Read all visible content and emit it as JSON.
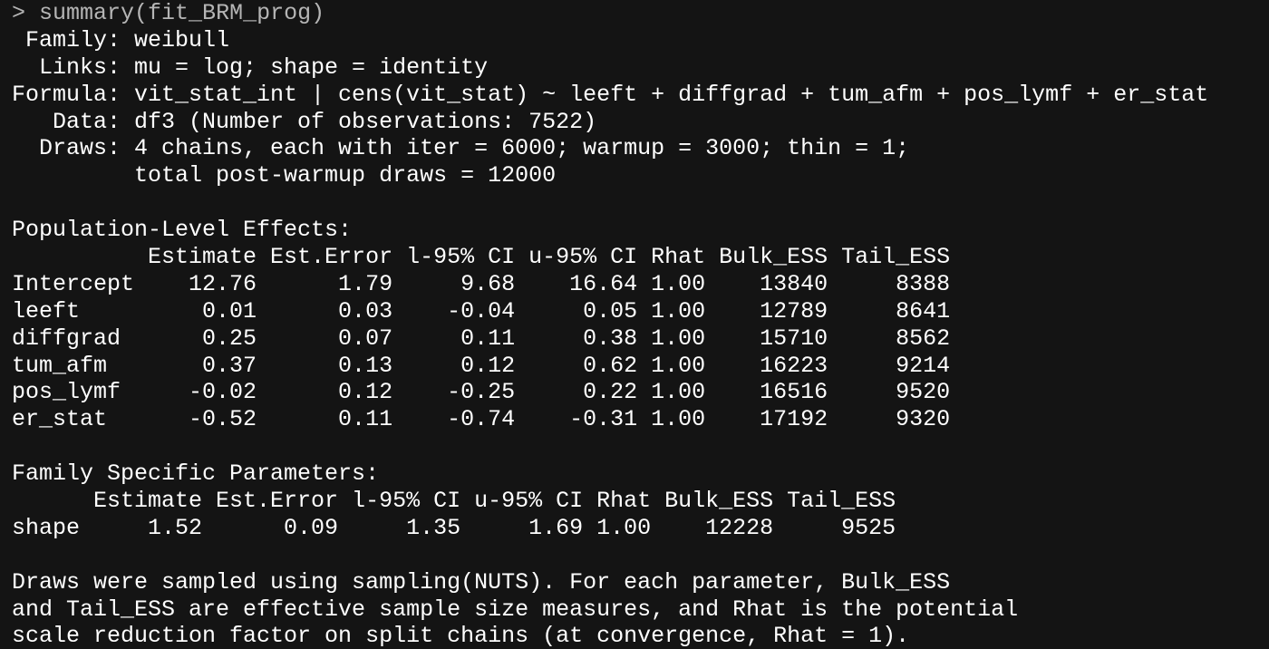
{
  "command": {
    "prompt": ">",
    "text": "summary(fit_BRM_prog)"
  },
  "header": {
    "family": " Family: weibull",
    "links": "  Links: mu = log; shape = identity",
    "formula": "Formula: vit_stat_int | cens(vit_stat) ~ leeft + diffgrad + tum_afm + pos_lymf + er_stat",
    "data": "   Data: df3 (Number of observations: 7522)",
    "draws": "  Draws: 4 chains, each with iter = 6000; warmup = 3000; thin = 1;",
    "draws_total": "         total post-warmup draws = 12000"
  },
  "population": {
    "title": "Population-Level Effects:",
    "header_row": "          Estimate Est.Error l-95% CI u-95% CI Rhat Bulk_ESS Tail_ESS",
    "rows": [
      "Intercept    12.76      1.79     9.68    16.64 1.00    13840     8388",
      "leeft         0.01      0.03    -0.04     0.05 1.00    12789     8641",
      "diffgrad      0.25      0.07     0.11     0.38 1.00    15710     8562",
      "tum_afm       0.37      0.13     0.12     0.62 1.00    16223     9214",
      "pos_lymf     -0.02      0.12    -0.25     0.22 1.00    16516     9520",
      "er_stat      -0.52      0.11    -0.74    -0.31 1.00    17192     9320"
    ]
  },
  "family_params": {
    "title": "Family Specific Parameters:",
    "header_row": "      Estimate Est.Error l-95% CI u-95% CI Rhat Bulk_ESS Tail_ESS",
    "rows": [
      "shape     1.52      0.09     1.35     1.69 1.00    12228     9525"
    ]
  },
  "footnote": [
    "Draws were sampled using sampling(NUTS). For each parameter, Bulk_ESS",
    "and Tail_ESS are effective sample size measures, and Rhat is the potential",
    "scale reduction factor on split chains (at convergence, Rhat = 1)."
  ],
  "colors": {
    "background": "#141414",
    "text": "#ffffff",
    "command_text": "#b5b5b5"
  }
}
